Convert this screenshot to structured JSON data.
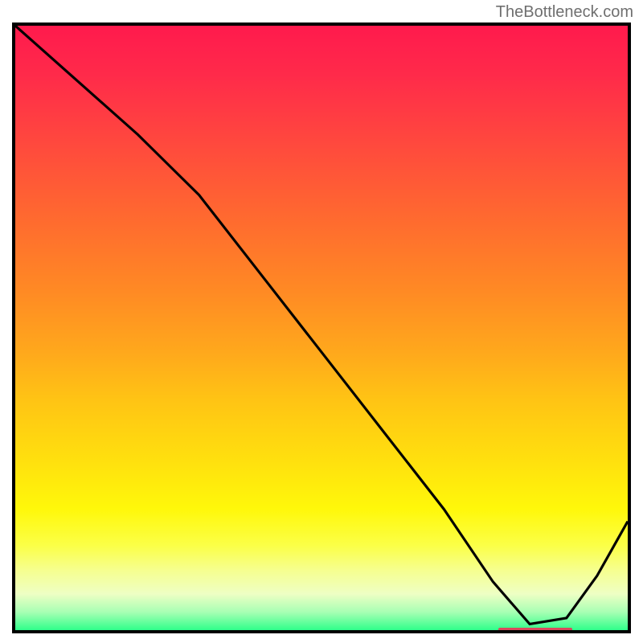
{
  "attribution": "TheBottleneck.com",
  "colors": {
    "curve": "#000000",
    "marker": "#d94a5c",
    "gradient_top": "#ff1a4d",
    "gradient_bottom": "#2fff8a"
  },
  "chart_data": {
    "type": "line",
    "title": "",
    "xlabel": "",
    "ylabel": "",
    "xlim": [
      0,
      100
    ],
    "ylim": [
      0,
      100
    ],
    "grid": false,
    "legend": false,
    "series": [
      {
        "name": "bottleneck-curve",
        "x": [
          0,
          10,
          20,
          30,
          40,
          50,
          60,
          70,
          78,
          84,
          90,
          95,
          100
        ],
        "y": [
          100,
          91,
          82,
          72,
          59,
          46,
          33,
          20,
          8,
          1,
          2,
          9,
          18
        ]
      }
    ],
    "annotations": [
      {
        "name": "optimal-range",
        "x_start": 78,
        "x_end": 90,
        "y": 1
      }
    ]
  }
}
